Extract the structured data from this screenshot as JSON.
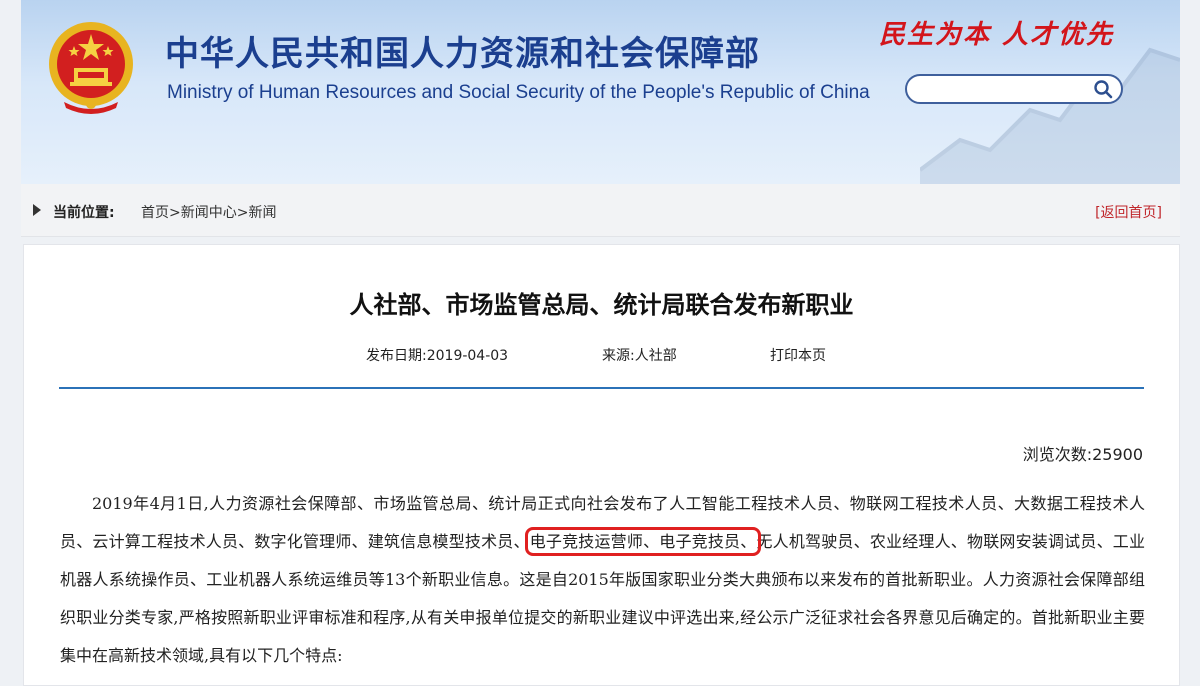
{
  "header": {
    "title_cn": "中华人民共和国人力资源和社会保障部",
    "title_en": "Ministry of Human Resources and Social Security of the People's Republic of China",
    "slogan": "民生为本 人才优先",
    "search_placeholder": "",
    "colors": {
      "brand_blue": "#1b3f8f",
      "slogan_red": "#d3151b"
    }
  },
  "breadcrumb": {
    "label": "当前位置:",
    "items": [
      "首页",
      ">",
      "新闻中心",
      ">",
      "新闻"
    ],
    "back_link": "[返回首页]"
  },
  "article": {
    "title": "人社部、市场监管总局、统计局联合发布新职业",
    "publish_date": "发布日期:2019-04-03",
    "source": "来源:人社部",
    "print": "打印本页",
    "views_label": "浏览次数:",
    "views_count": "25900",
    "paragraph_before": "2019年4月1日,人力资源社会保障部、市场监管总局、统计局正式向社会发布了人工智能工程技术人员、物联网工程技术人员、大数据工程技术人员、云计算工程技术人员、数字化管理师、建筑信息模型技术员、",
    "paragraph_highlight": "电子竞技运营师、电子竞技员、",
    "paragraph_after": "无人机驾驶员、农业经理人、物联网安装调试员、工业机器人系统操作员、工业机器人系统运维员等13个新职业信息。这是自2015年版国家职业分类大典颁布以来发布的首批新职业。人力资源社会保障部组织职业分类专家,严格按照新职业评审标准和程序,从有关申报单位提交的新职业建议中评选出来,经公示广泛征求社会各界意见后确定的。首批新职业主要集中在高新技术领域,具有以下几个特点:",
    "highlight_color": "#e02020"
  }
}
